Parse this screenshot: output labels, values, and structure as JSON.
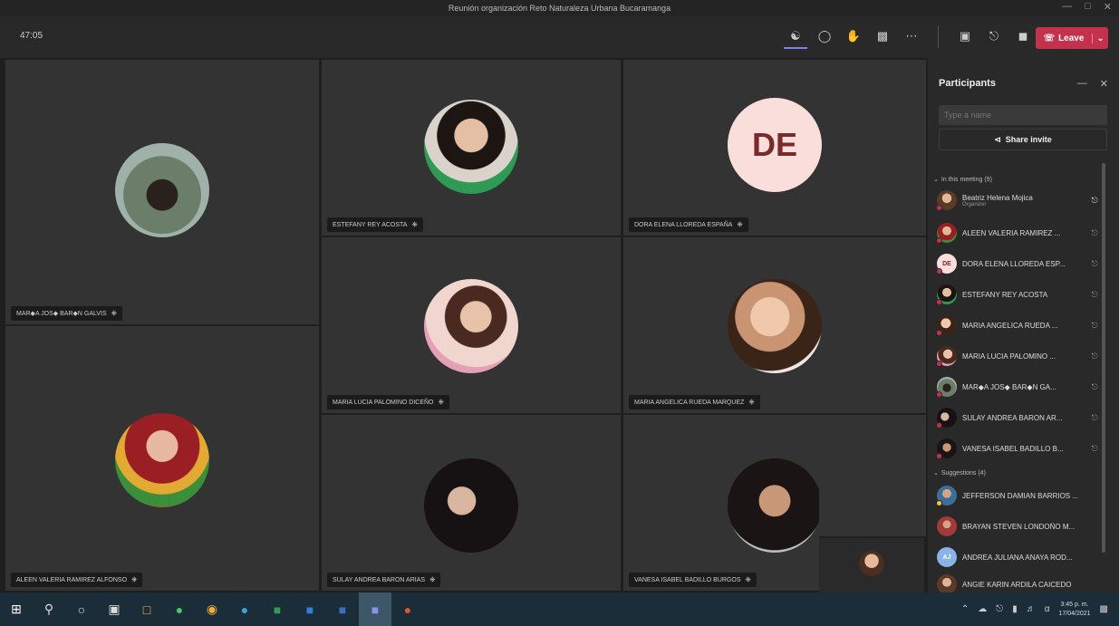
{
  "window": {
    "title": "Reunión organización Reto Naturaleza Urbana Bucaramanga"
  },
  "toolbar": {
    "timer": "47:05",
    "buttons": [
      "participants-icon",
      "chat-icon",
      "raise-hand-icon",
      "share-tray-icon",
      "more-icon",
      "camera-icon",
      "mic-icon",
      "share-screen-icon"
    ],
    "leave_label": "Leave"
  },
  "tiles": [
    {
      "name": "MAR◆A JOS◆ BAR◆N GALVIS",
      "initials": "",
      "photo": "person-outdoor"
    },
    {
      "name": "ESTEFANY REY ACOSTA",
      "initials": "",
      "photo": "person-green"
    },
    {
      "name": "DORA ELENA LLOREDA ESPAÑA",
      "initials": "DE",
      "photo": ""
    },
    {
      "name": "MARIA LUCIA PALOMINO DICEÑO",
      "initials": "",
      "photo": "person-glasses"
    },
    {
      "name": "MARIA ANGELICA RUEDA MARQUEZ",
      "initials": "",
      "photo": "person-light"
    },
    {
      "name": "ALEEN VALERIA RAMIREZ ALFONSO",
      "initials": "",
      "photo": "person-redhair"
    },
    {
      "name": "SULAY ANDREA BARON ARIAS",
      "initials": "",
      "photo": "person-dark"
    },
    {
      "name": "VANESA ISABEL BADILLO BURGOS",
      "initials": "",
      "photo": "person-hair"
    }
  ],
  "panel": {
    "title": "Participants",
    "search_placeholder": "Type a name",
    "share_invite": "Share invite",
    "in_meeting_label": "In this meeting (9)",
    "in_meeting": [
      {
        "name": "Beatriz Helena Mojica",
        "role": "Organizer",
        "initials": "",
        "mic": "on"
      },
      {
        "name": "ALEEN VALERIA RAMIREZ ...",
        "role": "",
        "initials": "",
        "mic": "muted"
      },
      {
        "name": "DORA ELENA LLOREDA ESP...",
        "role": "",
        "initials": "DE",
        "mic": "muted"
      },
      {
        "name": "ESTEFANY REY ACOSTA",
        "role": "",
        "initials": "",
        "mic": "muted"
      },
      {
        "name": "MARIA ANGELICA RUEDA ...",
        "role": "",
        "initials": "",
        "mic": "muted"
      },
      {
        "name": "MARIA LUCIA PALOMINO ...",
        "role": "",
        "initials": "",
        "mic": "muted"
      },
      {
        "name": "MAR◆A JOS◆ BAR◆N GA...",
        "role": "",
        "initials": "",
        "mic": "muted"
      },
      {
        "name": "SULAY ANDREA BARON AR...",
        "role": "",
        "initials": "",
        "mic": "muted"
      },
      {
        "name": "VANESA ISABEL BADILLO B...",
        "role": "",
        "initials": "",
        "mic": "muted"
      }
    ],
    "suggestions_label": "Suggestions (4)",
    "suggestions": [
      {
        "name": "JEFFERSON DAMIAN BARRIOS ...",
        "initials": ""
      },
      {
        "name": "BRAYAN STEVEN LONDOÑO M...",
        "initials": ""
      },
      {
        "name": "ANDREA JULIANA ANAYA ROD...",
        "initials": "AJ"
      },
      {
        "name": "ANGIE KARIN ARDILA CAICEDO",
        "initials": ""
      }
    ]
  },
  "taskbar": {
    "apps": [
      "windows-icon",
      "search-icon",
      "cortana-icon",
      "task-view-icon",
      "file-explorer-icon",
      "whatsapp-icon",
      "chrome-icon",
      "edge-icon",
      "excel-icon",
      "outlook-icon",
      "word-icon",
      "teams-icon",
      "app-icon"
    ],
    "time": "3:45 p. m.",
    "date": "17/04/2021"
  },
  "colors": {
    "leave": "#c4314b",
    "accent": "#7b83eb",
    "tile": "#333333",
    "panel": "#292929",
    "taskbar": "#1c2d3a"
  }
}
